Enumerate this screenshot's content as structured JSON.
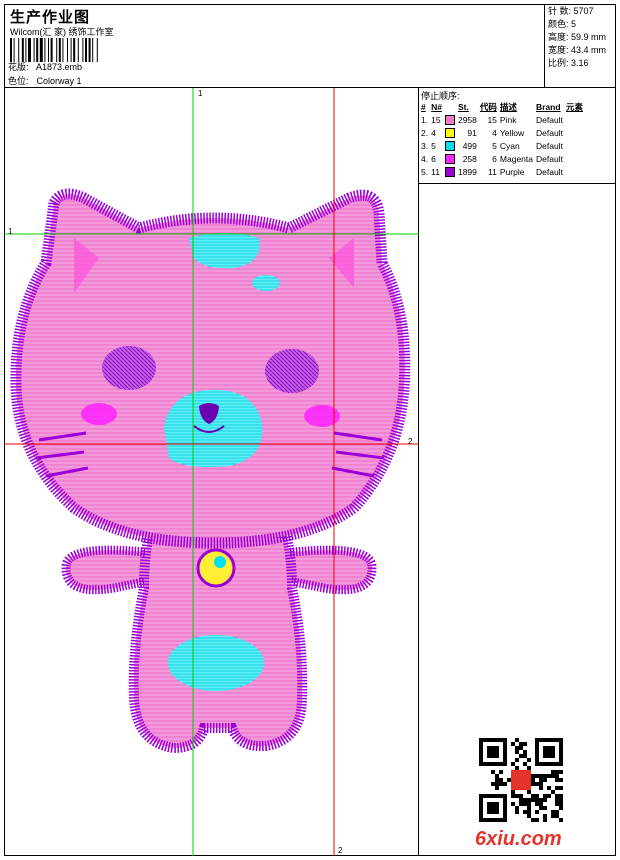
{
  "header": {
    "title": "生产作业图",
    "studio": "Wilcom(汇 家) 绣饰工作室",
    "design_label": "花版:",
    "design_file": "A1873.emb",
    "colorway_label": "色位:",
    "colorway": "Colorway 1"
  },
  "stats": [
    {
      "label": "针 数:",
      "value": "5707"
    },
    {
      "label": "颜色:",
      "value": "5"
    },
    {
      "label": "高度:",
      "value": "59.9 mm"
    },
    {
      "label": "宽度:",
      "value": "43.4 mm"
    },
    {
      "label": "比例:",
      "value": "3.16"
    }
  ],
  "stop_sequence": {
    "title": "停止顺序:",
    "headers": [
      "#",
      "N#",
      "St.",
      "代码",
      "描述",
      "Brand",
      "元素"
    ],
    "rows": [
      {
        "idx": "1.",
        "n": "15",
        "color": "#f07ac8",
        "st": "2958",
        "code": "15",
        "desc": "Pink",
        "brand": "Default"
      },
      {
        "idx": "2.",
        "n": "4",
        "color": "#ffff00",
        "st": "91",
        "code": "4",
        "desc": "Yellow",
        "brand": "Default"
      },
      {
        "idx": "3.",
        "n": "5",
        "color": "#00e0f0",
        "st": "499",
        "code": "5",
        "desc": "Cyan",
        "brand": "Default"
      },
      {
        "idx": "4.",
        "n": "6",
        "color": "#ff22ff",
        "st": "258",
        "code": "6",
        "desc": "Magenta",
        "brand": "Default"
      },
      {
        "idx": "5.",
        "n": "11",
        "color": "#9a00d8",
        "st": "1899",
        "code": "11",
        "desc": "Purple",
        "brand": "Default"
      }
    ]
  },
  "axes": {
    "green_v": "1",
    "green_h": "1",
    "red_h": "2",
    "red_v": "2"
  },
  "watermark": "6xiu.com",
  "colors": {
    "pink": "#f07ac8",
    "purple": "#9a00d8",
    "cyan": "#00e0f0",
    "magenta": "#ff22ff",
    "yellow": "#ffff00",
    "green_guide": "#00cc00",
    "red_guide": "#ee0000"
  }
}
